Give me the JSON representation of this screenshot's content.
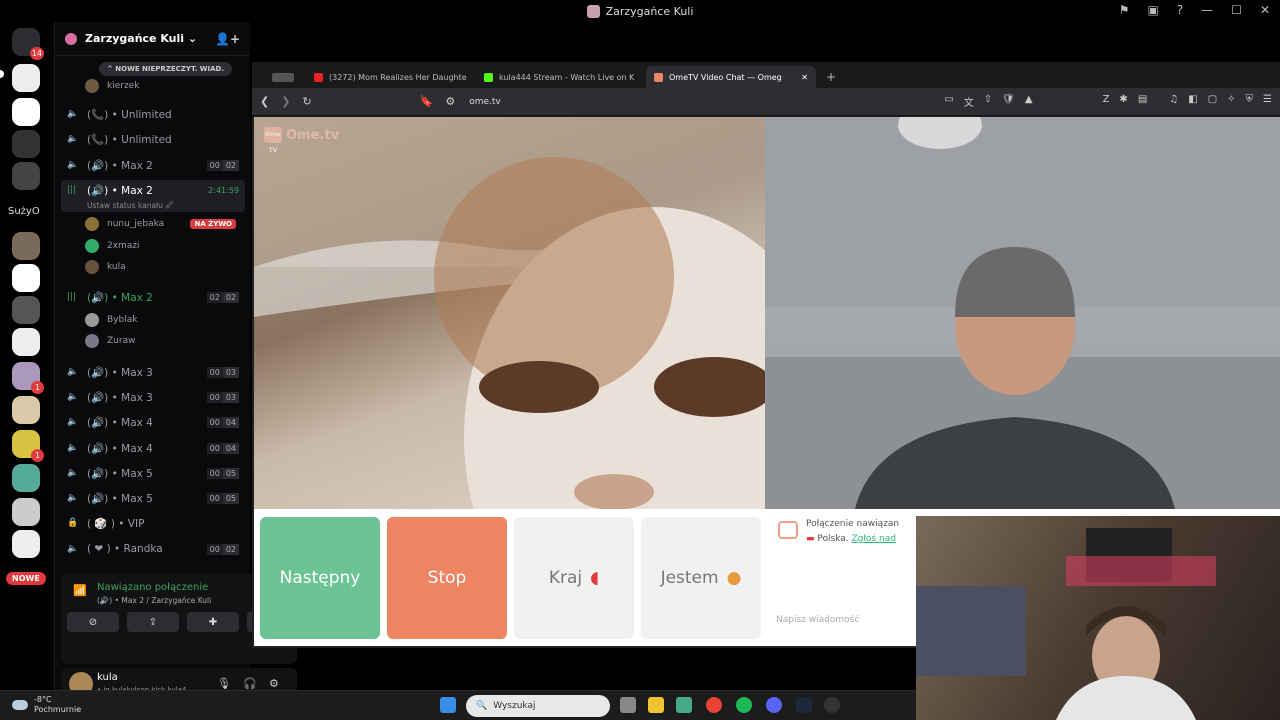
{
  "window": {
    "title": "Zarzygańce Kuli"
  },
  "servers": {
    "badge_top": "14",
    "text_server": "SużyO",
    "badge_1": "1",
    "badge_2": "1",
    "new_label": "NOWE"
  },
  "guild": {
    "name": "Zarzygańce Kuli ⌄",
    "unread_pill": "^ NOWE NIEPRZECZYT. WIAD."
  },
  "channels": [
    {
      "label": "kierzek"
    },
    {
      "label": "(📞) • Unlimited"
    },
    {
      "label": "(📞) • Unlimited"
    },
    {
      "label": "(🔊) • Max 2",
      "count_a": "00",
      "count_b": "02"
    },
    {
      "label": "(🔊) • Max 2",
      "timer": "2:41:59",
      "status": "Ustaw status kanału 🖉"
    },
    {
      "label": "(🔊) • Max 2",
      "count_a": "02",
      "count_b": "02"
    },
    {
      "label": "(🔊) • Max 3",
      "count_a": "00",
      "count_b": "03"
    },
    {
      "label": "(🔊) • Max 3",
      "count_a": "00",
      "count_b": "03"
    },
    {
      "label": "(🔊) • Max 4",
      "count_a": "00",
      "count_b": "04"
    },
    {
      "label": "(🔊) • Max 4",
      "count_a": "00",
      "count_b": "04"
    },
    {
      "label": "(🔊) • Max 5",
      "count_a": "00",
      "count_b": "05"
    },
    {
      "label": "(🔊) • Max 5",
      "count_a": "00",
      "count_b": "05"
    },
    {
      "label": "( 🎲 ) • VIP"
    },
    {
      "label": "( ❤ ) • Randka",
      "count_a": "00",
      "count_b": "02"
    }
  ],
  "members": {
    "m1": "nunu_jebaka",
    "live": "NA ŻYWO",
    "m2": "2xmazi",
    "m3": "kula",
    "m4": "Byblak",
    "m5": "Zuraw"
  },
  "voice": {
    "connected": "Nawiązano połączenie",
    "location": "(🔊) • Max 2 / Zarzygańce Kuli"
  },
  "user": {
    "name": "kula",
    "status": "• ig kulakulson kick kula4..."
  },
  "browser": {
    "tabs": [
      {
        "title": "(3272) Mom Realizes Her Daughte"
      },
      {
        "title": "kula444 Stream - Watch Live on K"
      },
      {
        "title": "OmeTV Video Chat — Omeg"
      }
    ],
    "url": "ome.tv"
  },
  "ometv": {
    "logo": "Ome.tv",
    "logo_box": "Ome TV",
    "buttons": {
      "next": "Następny",
      "stop": "Stop",
      "country": "Kraj",
      "gender": "Jestem"
    },
    "chat": {
      "line1": "Połączenie nawiązan",
      "line2": "Polska.",
      "report": "Zgłoś nad",
      "placeholder": "Napisz wiadomość"
    }
  },
  "taskbar": {
    "temp": "-8°C",
    "weather": "Pochmurnie",
    "search": "Wyszukaj"
  }
}
